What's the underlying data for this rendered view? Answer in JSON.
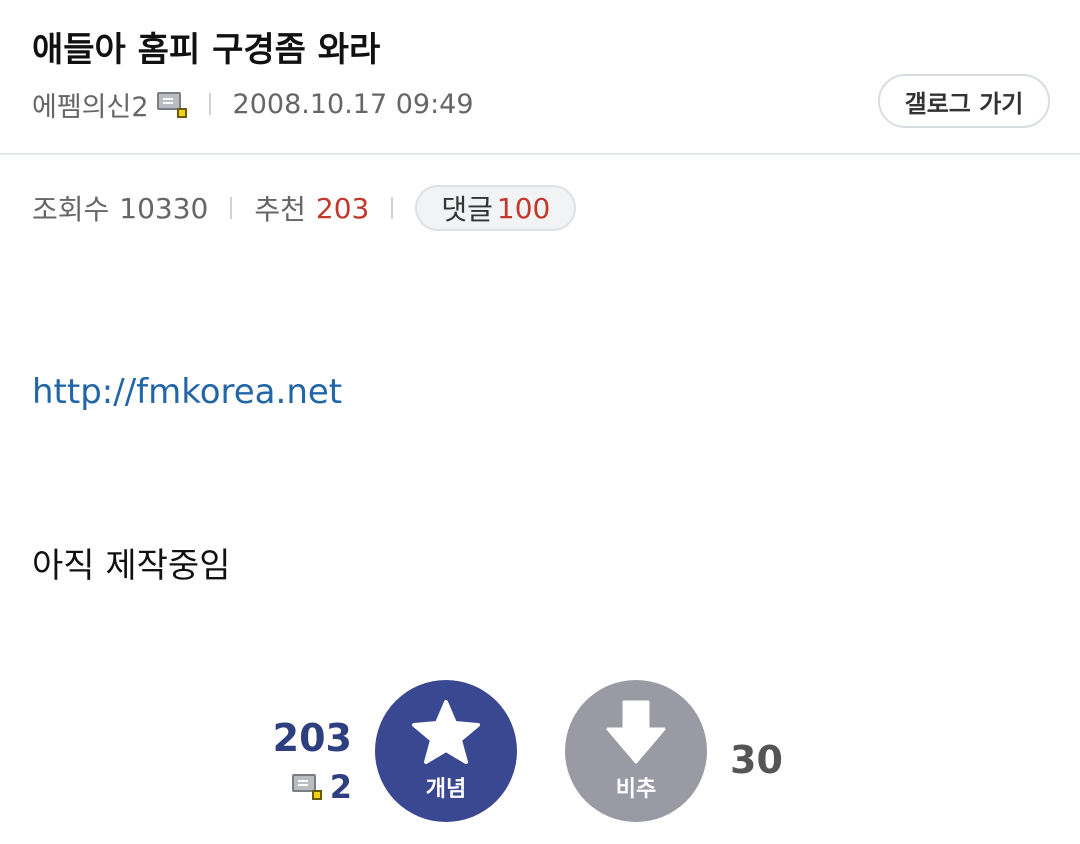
{
  "post": {
    "title": "애들아 홈피 구경좀 와라",
    "author": "에펨의신2",
    "date": "2008.10.17 09:49",
    "gallery_button": "갤로그 가기"
  },
  "stats": {
    "views_label": "조회수",
    "views": "10330",
    "recommend_label": "추천",
    "recommend": "203",
    "comments_label": "댓글",
    "comments": "100"
  },
  "content": {
    "link": "http://fmkorea.net",
    "text": "아직 제작중임"
  },
  "vote": {
    "up_count": "203",
    "up_level": "2",
    "up_label": "개념",
    "down_label": "비추",
    "down_count": "30"
  },
  "colors": {
    "up_button": "#3a4791",
    "down_button": "#9a9aa4",
    "accent_red": "#c0392b",
    "link": "#2266a8"
  },
  "icons": {
    "level": "level-icon",
    "star": "star-icon",
    "down_arrow": "arrow-down-icon"
  }
}
